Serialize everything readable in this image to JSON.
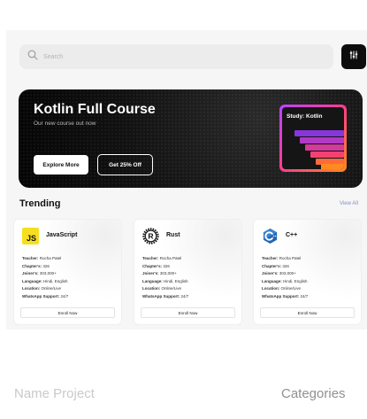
{
  "search": {
    "placeholder": "Search"
  },
  "banner": {
    "title": "Kotlin Full Course",
    "subtitle": "Our new course out now",
    "primary_button": "Explore More",
    "secondary_button": "Get 25% Off",
    "cover_label": "Study: Kotlin"
  },
  "trending": {
    "heading": "Trending",
    "view_all": "View All",
    "courses": [
      {
        "name": "JavaScript",
        "icon": "javascript-logo-icon",
        "teacher": "Rocha Patel",
        "chapters": "326",
        "joiners": "303,000+",
        "language": "Hindi, English",
        "location": "Online/Live",
        "support": "24/7",
        "button": "Enroll Now"
      },
      {
        "name": "Rust",
        "icon": "rust-logo-icon",
        "teacher": "Rocha Patel",
        "chapters": "326",
        "joiners": "303,000+",
        "language": "Hindi, English",
        "location": "Online/Live",
        "support": "24/7",
        "button": "Enroll Now"
      },
      {
        "name": "C++",
        "icon": "cpp-logo-icon",
        "teacher": "Rocha Patel",
        "chapters": "326",
        "joiners": "303,000+",
        "language": "Hindi, English",
        "location": "Online/Live",
        "support": "24/7",
        "button": "Enroll Now"
      }
    ],
    "labels": {
      "teacher": "Teacher:",
      "chapters": "Chapter's:",
      "joiners": "Joiner's:",
      "language": "Language:",
      "location": "Location:",
      "support": "WhatsApp Support:"
    }
  },
  "footer": {
    "left": "Name Project",
    "right": "Categories"
  },
  "colors": {
    "accent_dark": "#0d0d0d",
    "book_gradient": [
      "#b844ff",
      "#ff3d8b",
      "#ff8a1f"
    ],
    "view_all": "#7f8fbf"
  }
}
